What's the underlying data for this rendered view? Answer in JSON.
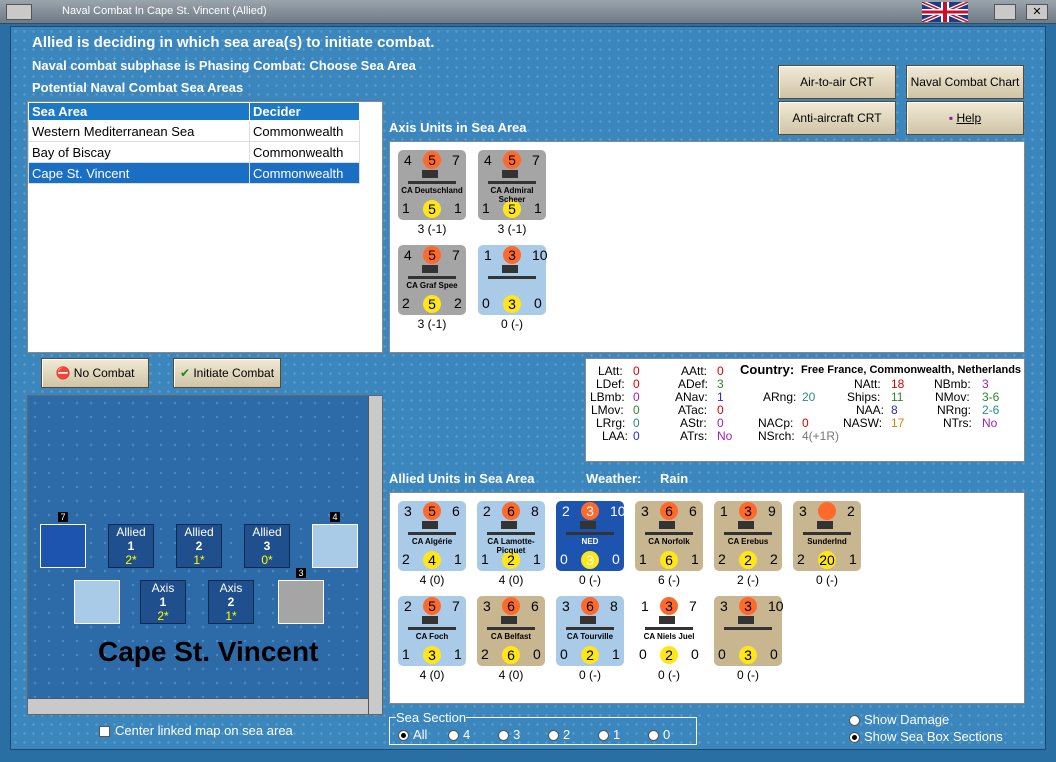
{
  "window": {
    "title": "Naval Combat In Cape St. Vincent (Allied)",
    "close_glyph": "✕"
  },
  "header": {
    "line1": "Allied is deciding in which sea area(s) to initiate combat.",
    "line2": "Naval combat subphase is Phasing Combat: Choose Sea Area",
    "line3": "Potential Naval Combat Sea Areas"
  },
  "buttons": {
    "air_to_air": "Air-to-air CRT",
    "naval_chart": "Naval Combat Chart",
    "anti_aircraft": "Anti-aircraft CRT",
    "help": "Help",
    "no_combat": "No Combat",
    "initiate": "Initiate Combat"
  },
  "sea_table": {
    "headers": [
      "Sea Area",
      "Decider"
    ],
    "rows": [
      [
        "Western Mediterranean Sea",
        "Commonwealth"
      ],
      [
        "Bay of Biscay",
        "Commonwealth"
      ],
      [
        "Cape St. Vincent",
        "Commonwealth"
      ]
    ],
    "selected": 2
  },
  "axis": {
    "title": "Axis Units in Sea Area",
    "units": [
      {
        "tl": "4",
        "tm": "5",
        "tr": "7",
        "name": "CA Deutschland",
        "bl": "1",
        "bm": "5",
        "br": "1",
        "val": "3 (-1)",
        "color": "grey"
      },
      {
        "tl": "4",
        "tm": "5",
        "tr": "7",
        "name": "CA Admiral Scheer",
        "bl": "1",
        "bm": "5",
        "br": "1",
        "val": "3 (-1)",
        "color": "grey"
      },
      {
        "tl": "4",
        "tm": "5",
        "tr": "7",
        "name": "CA Graf Spee",
        "bl": "2",
        "bm": "5",
        "br": "2",
        "val": "3 (-1)",
        "color": "grey"
      },
      {
        "tl": "1",
        "tm": "3",
        "tr": "10",
        "name": "",
        "bl": "0",
        "bm": "3",
        "br": "0",
        "val": "0 (-)",
        "color": "lblue"
      }
    ]
  },
  "stats": {
    "LAtt": "0",
    "LDef": "0",
    "LBmb": "0",
    "LMov": "0",
    "LRrg": "0",
    "LAA": "0",
    "AAtt": "0",
    "ADef": "3",
    "ANav": "1",
    "ATac": "0",
    "AStr": "0",
    "ATrs": "No",
    "ARng": "20",
    "NACp": "0",
    "NSrch": "4(+1R)",
    "country_label": "Country:",
    "country": "Free France, Commonwealth, Netherlands",
    "NAtt": "18",
    "Ships": "11",
    "NAA": "8",
    "NASW": "17",
    "NBmb": "3",
    "NMov": "3-6",
    "NRng": "2-6",
    "NTrs": "No"
  },
  "allied": {
    "title": "Allied Units in Sea Area",
    "weather_label": "Weather:",
    "weather": "Rain",
    "units": [
      {
        "tl": "3",
        "tm": "5",
        "tr": "6",
        "name": "CA Algérie",
        "bl": "2",
        "bm": "4",
        "br": "1",
        "val": "4 (0)",
        "color": "lblue"
      },
      {
        "tl": "2",
        "tm": "6",
        "tr": "8",
        "name": "CA Lamotte-Picquet",
        "bl": "1",
        "bm": "2",
        "br": "1",
        "val": "4 (0)",
        "color": "lblue"
      },
      {
        "tl": "2",
        "tm": "3",
        "tr": "10",
        "name": "NED",
        "bl": "0",
        "bm": "3",
        "br": "0",
        "val": "0 (-)",
        "color": "dblue"
      },
      {
        "tl": "3",
        "tm": "6",
        "tr": "6",
        "name": "CA Norfolk",
        "bl": "1",
        "bm": "6",
        "br": "1",
        "val": "6 (-)",
        "color": "tan"
      },
      {
        "tl": "1",
        "tm": "3",
        "tr": "9",
        "name": "CA Erebus",
        "bl": "2",
        "bm": "2",
        "br": "2",
        "val": "2 (-)",
        "color": "tan"
      },
      {
        "tl": "3",
        "tm": "",
        "tr": "2",
        "name": "SunderInd",
        "bl": "2",
        "bm": "20",
        "br": "1",
        "val": "0 (-)",
        "color": "tan"
      },
      {
        "tl": "2",
        "tm": "5",
        "tr": "7",
        "name": "CA Foch",
        "bl": "1",
        "bm": "3",
        "br": "1",
        "val": "4 (0)",
        "color": "lblue"
      },
      {
        "tl": "3",
        "tm": "6",
        "tr": "6",
        "name": "CA Belfast",
        "bl": "2",
        "bm": "6",
        "br": "0",
        "val": "4 (0)",
        "color": "tan"
      },
      {
        "tl": "3",
        "tm": "6",
        "tr": "8",
        "name": "CA Tourville",
        "bl": "0",
        "bm": "2",
        "br": "1",
        "val": "0 (-)",
        "color": "lblue"
      },
      {
        "tl": "1",
        "tm": "3",
        "tr": "7",
        "name": "CA Niels Juel",
        "bl": "0",
        "bm": "2",
        "br": "0",
        "val": "0 (-)",
        "color": "white"
      },
      {
        "tl": "3",
        "tm": "3",
        "tr": "10",
        "name": "",
        "bl": "0",
        "bm": "3",
        "br": "0",
        "val": "0 (-)",
        "color": "tan"
      }
    ]
  },
  "map": {
    "sea_name": "Cape St. Vincent",
    "boxes": [
      {
        "side": "Allied",
        "num": "1",
        "val": "2*"
      },
      {
        "side": "Allied",
        "num": "2",
        "val": "1*"
      },
      {
        "side": "Allied",
        "num": "3",
        "val": "0*"
      },
      {
        "side": "Axis",
        "num": "1",
        "val": "2*"
      },
      {
        "side": "Axis",
        "num": "2",
        "val": "1*"
      }
    ],
    "stack_counts": [
      "7",
      "4",
      "3"
    ],
    "center_label": "Center linked map on sea area"
  },
  "sea_section": {
    "label": "Sea Section",
    "options": [
      "All",
      "4",
      "3",
      "2",
      "1",
      "0"
    ],
    "selected": "All"
  },
  "options": {
    "show_damage": "Show Damage",
    "show_sea_box": "Show Sea Box Sections"
  }
}
